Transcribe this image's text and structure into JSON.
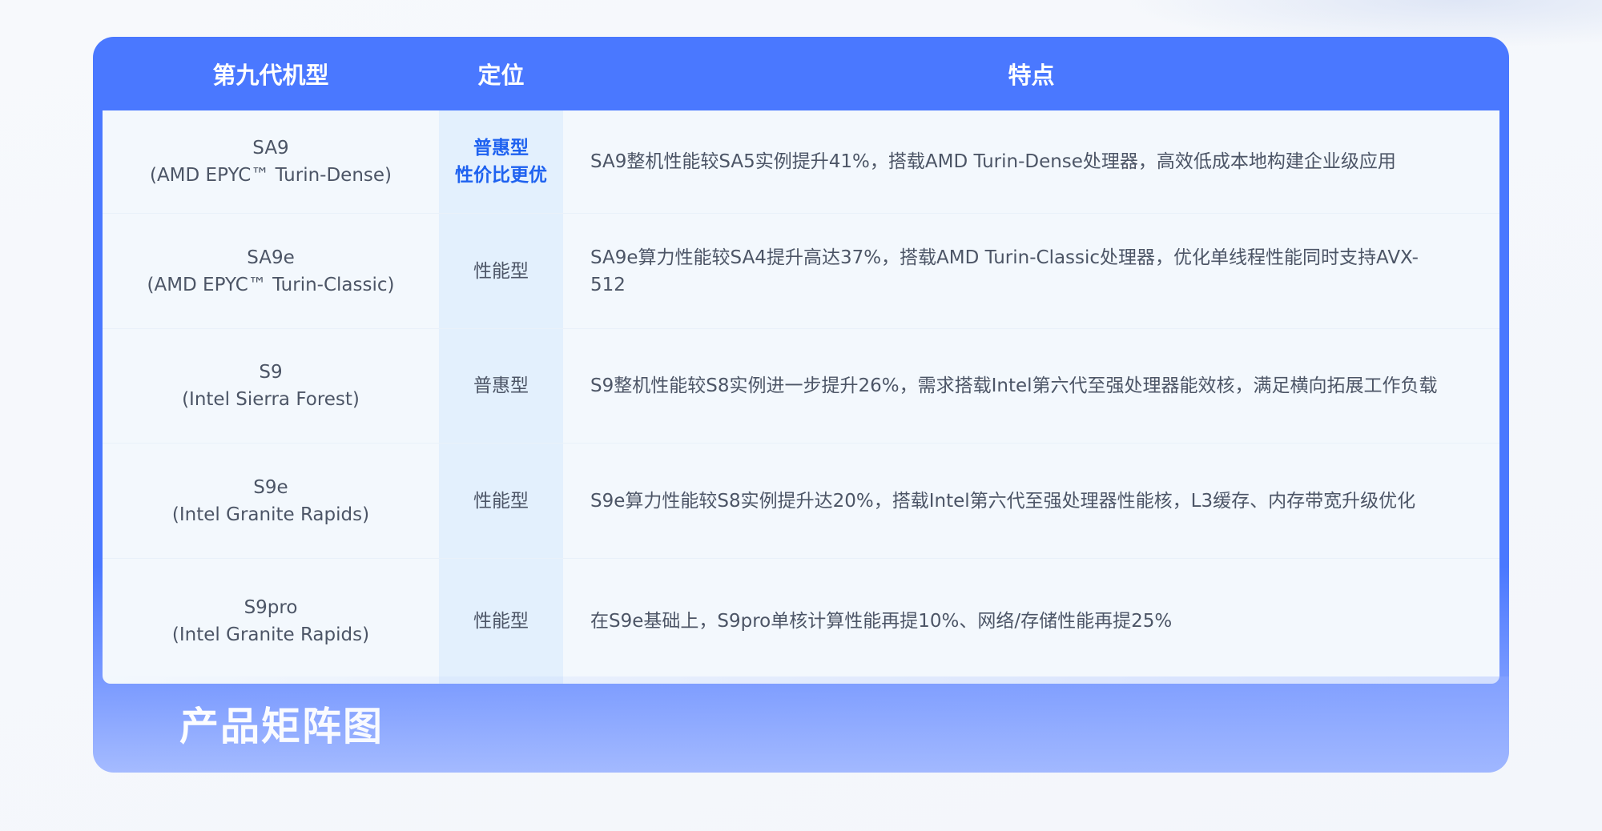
{
  "header": {
    "col_model": "第九代机型",
    "col_position": "定位",
    "col_features": "特点"
  },
  "rows": [
    {
      "model": "SA9",
      "cpu": "(AMD EPYC™ Turin-Dense)",
      "position": [
        "普惠型",
        "性价比更优"
      ],
      "features": "SA9整机性能较SA5实例提升41%，搭载AMD Turin-Dense处理器，高效低成本地构建企业级应用"
    },
    {
      "model": "SA9e",
      "cpu": "(AMD EPYC™ Turin-Classic)",
      "position": [
        "性能型"
      ],
      "features": "SA9e算力性能较SA4提升高达37%，搭载AMD Turin-Classic处理器，优化单线程性能同时支持AVX-512"
    },
    {
      "model": "S9",
      "cpu": "(Intel Sierra Forest)",
      "position": [
        "普惠型"
      ],
      "features": "S9整机性能较S8实例进一步提升26%，需求搭载Intel第六代至强处理器能效核，满足横向拓展工作负载"
    },
    {
      "model": "S9e",
      "cpu": "(Intel Granite Rapids)",
      "position": [
        "性能型"
      ],
      "features": "S9e算力性能较S8实例提升达20%，搭载Intel第六代至强处理器性能核，L3缓存、内存带宽升级优化"
    },
    {
      "model": "S9pro",
      "cpu": "(Intel Granite Rapids)",
      "position": [
        "性能型"
      ],
      "features": "在S9e基础上，S9pro单核计算性能再提10%、网络/存储性能再提25%"
    }
  ],
  "footer": {
    "title": "产品矩阵图"
  },
  "colors": {
    "brand_blue": "#4a78ff",
    "highlight_text": "#1f62f0",
    "body_text": "#4c5566"
  }
}
